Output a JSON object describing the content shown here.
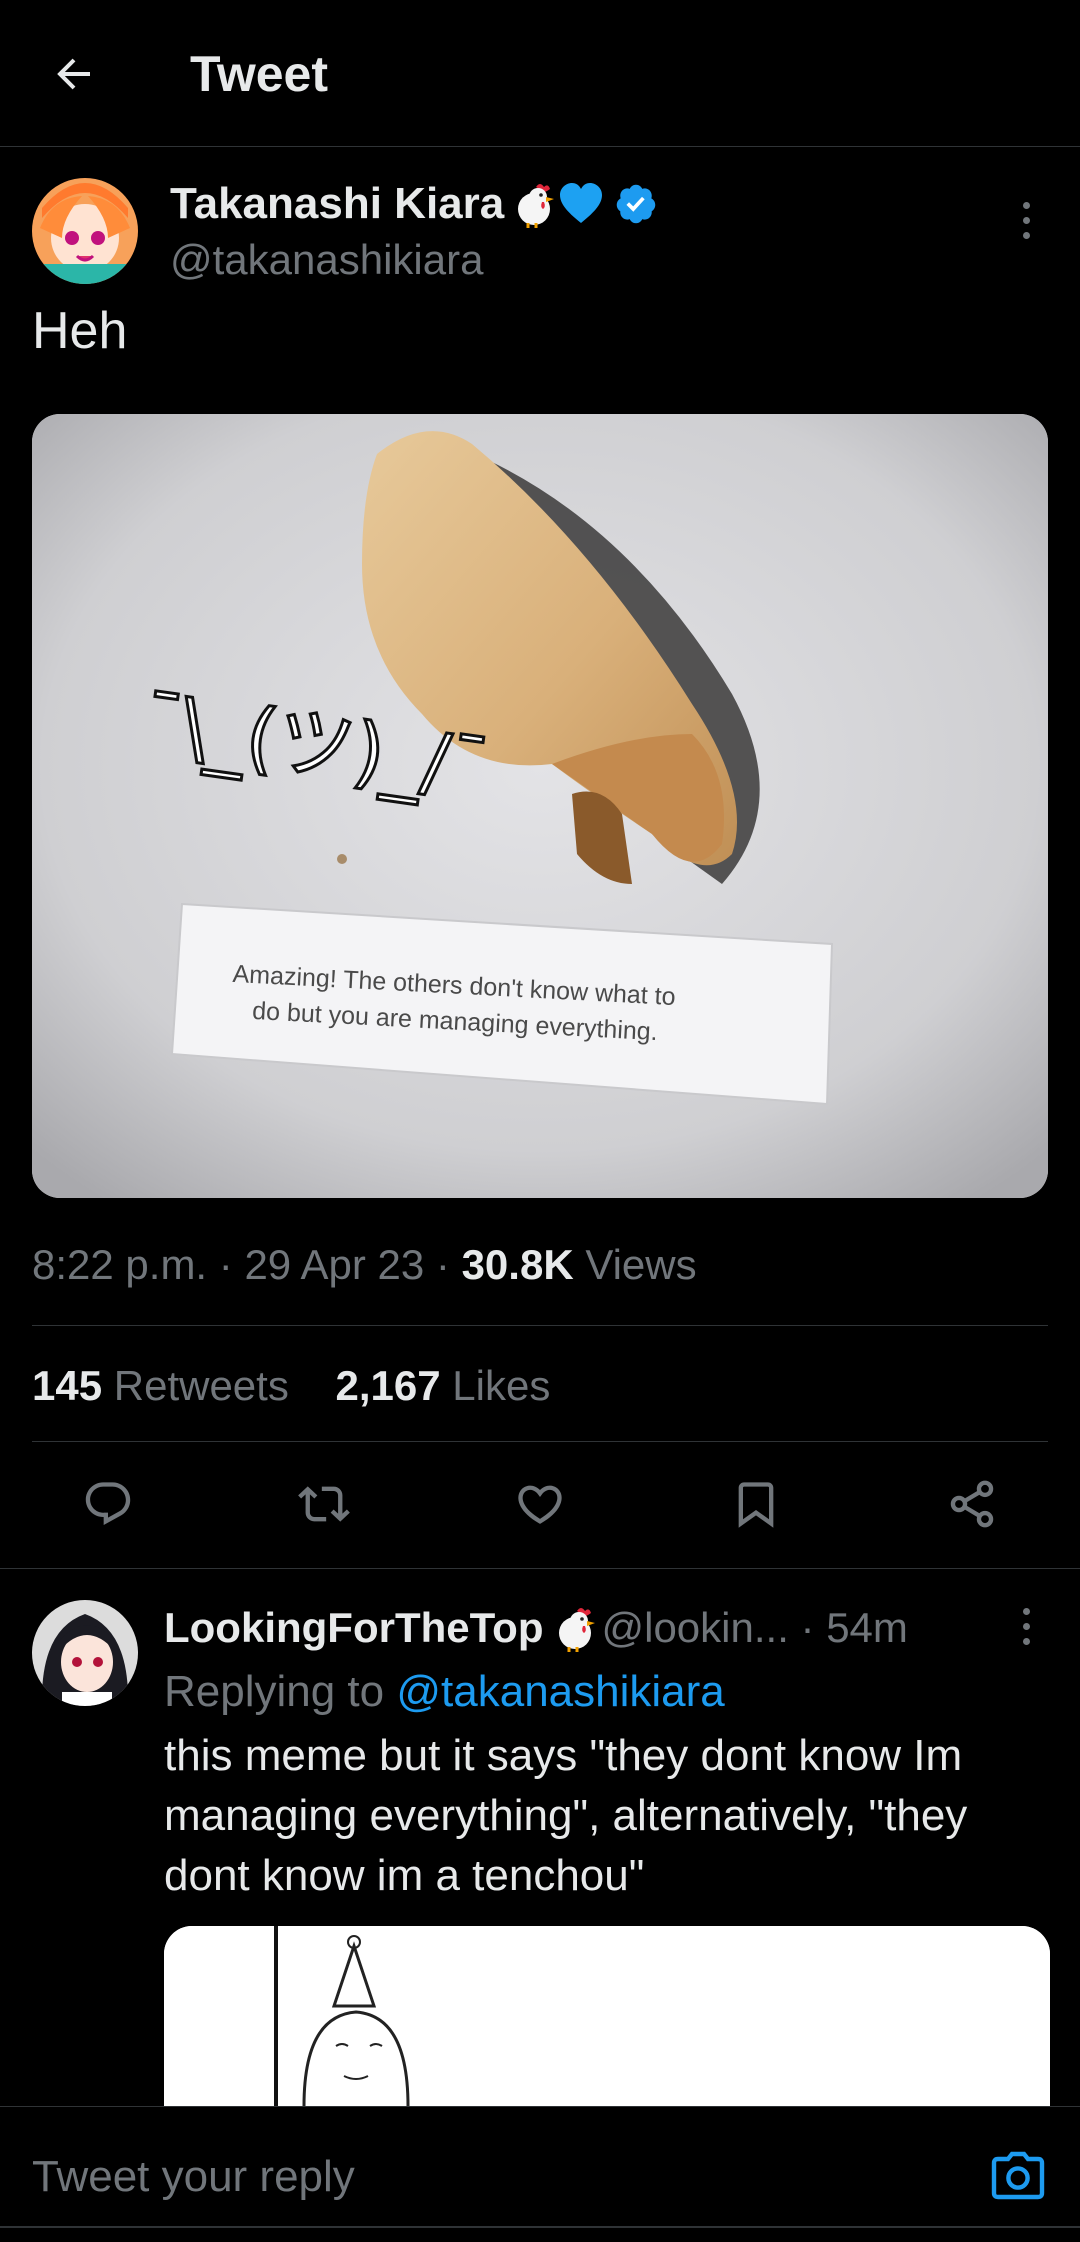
{
  "header": {
    "title": "Tweet"
  },
  "tweet": {
    "author_name": "Takanashi Kiara",
    "author_handle": "@takanashikiara",
    "text": "Heh",
    "media": {
      "overlay_text": "¯\\_(ツ)_/¯",
      "fortune_line1": "Amazing! The others don't know what to",
      "fortune_line2": "do but you are managing everything."
    },
    "time": "8:22 p.m.",
    "date": "29 Apr 23",
    "views_count": "30.8K",
    "views_label": "Views",
    "retweets_count": "145",
    "retweets_label": "Retweets",
    "likes_count": "2,167",
    "likes_label": "Likes"
  },
  "reply": {
    "name": "LookingForTheTop",
    "handle": "@lookin...",
    "time": "54m",
    "replying_prefix": "Replying to",
    "replying_to": "@takanashikiara",
    "text": "this meme but it says \"they dont know Im managing everything\", alternatively, \"they dont know im a tenchou\""
  },
  "composer": {
    "placeholder": "Tweet your reply"
  },
  "icons": {
    "back": "arrow-left-icon",
    "verified": "verified-badge-icon",
    "more": "more-vertical-icon",
    "reply": "reply-icon",
    "retweet": "retweet-icon",
    "like": "heart-icon",
    "bookmark": "bookmark-icon",
    "share": "share-icon",
    "camera": "camera-icon"
  },
  "colors": {
    "accent": "#1d9bf0",
    "background": "#000000",
    "muted": "#71767b",
    "text": "#e7e9ea"
  }
}
